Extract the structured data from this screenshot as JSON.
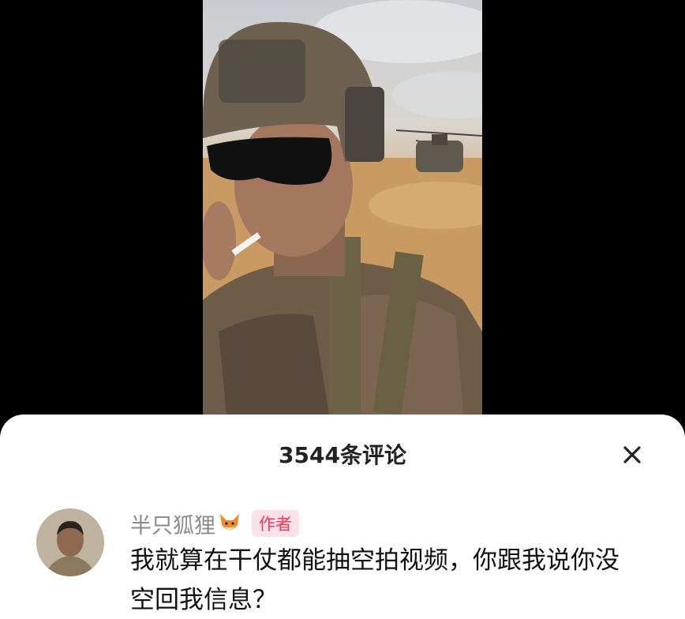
{
  "video": {
    "description_icon": "video-frame"
  },
  "comments_panel": {
    "title": "3544条评论",
    "close_icon": "close-icon"
  },
  "comment": {
    "author_name": "半只狐狸",
    "author_emoji": "🦊",
    "author_badge": "作者",
    "text": "我就算在干仗都能抽空拍视频，你跟我说你没空回我信息？"
  },
  "colors": {
    "badge_bg": "#fde1e8",
    "badge_text": "#f2355b",
    "name_text": "#8a8a8e"
  }
}
